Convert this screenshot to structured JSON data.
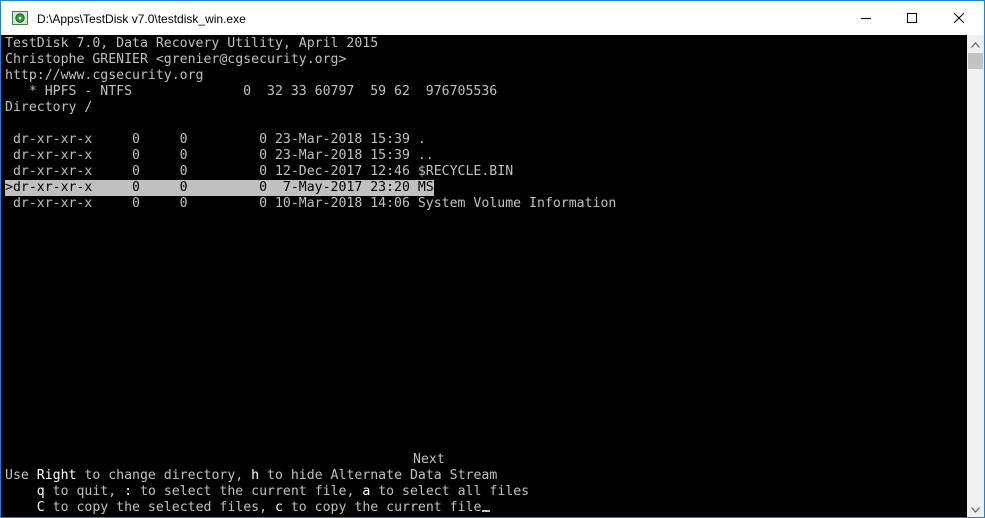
{
  "window": {
    "title": "D:\\Apps\\TestDisk v7.0\\testdisk_win.exe",
    "accent": "#1883d7"
  },
  "console": {
    "header": [
      "TestDisk 7.0, Data Recovery Utility, April 2015",
      "Christophe GRENIER <grenier@cgsecurity.org>",
      "http://www.cgsecurity.org",
      "   * HPFS - NTFS              0  32 33 60797  59 62  976705536",
      "Directory /"
    ],
    "entries": [
      " dr-xr-xr-x     0     0         0 23-Mar-2018 15:39 .",
      " dr-xr-xr-x     0     0         0 23-Mar-2018 15:39 ..",
      " dr-xr-xr-x     0     0         0 12-Dec-2017 12:46 $RECYCLE.BIN",
      ">dr-xr-xr-x     0     0         0  7-May-2017 23:20 MS",
      " dr-xr-xr-x     0     0         0 10-Mar-2018 14:06 System Volume Information"
    ],
    "selected_index": 3,
    "next_label": "Next",
    "help": {
      "l1_a": "Use ",
      "l1_b": "Right",
      "l1_c": " to change directory, ",
      "l1_d": "h",
      "l1_e": " to hide Alternate Data Stream",
      "l2_a": "    ",
      "l2_b": "q",
      "l2_c": " to quit, ",
      "l2_d": ":",
      "l2_e": " to select the current file, ",
      "l2_f": "a",
      "l2_g": " to select all files",
      "l3_a": "    ",
      "l3_b": "C",
      "l3_c": " to copy the selected files, ",
      "l3_d": "c",
      "l3_e": " to copy the current file"
    }
  },
  "icons": {
    "app": "testdisk-app-icon",
    "minimize": "minimize-icon",
    "maximize": "maximize-icon",
    "close": "close-icon",
    "scroll_up": "scroll-up-arrow-icon",
    "scroll_down": "scroll-down-arrow-icon"
  }
}
